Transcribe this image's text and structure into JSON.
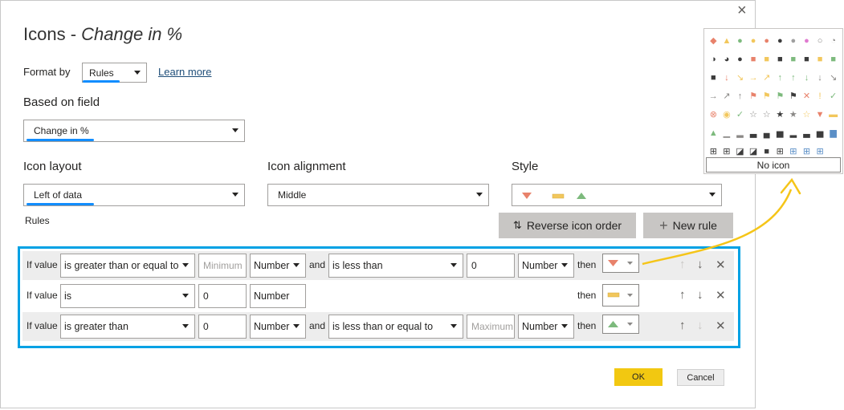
{
  "dialog": {
    "title_main": "Icons - ",
    "title_italic": "Change in %",
    "close": "×"
  },
  "format_by": {
    "label": "Format by",
    "value": "Rules",
    "learn_more": "Learn more"
  },
  "based_on_field": {
    "label": "Based on field",
    "value": "Change in %"
  },
  "icon_layout": {
    "label": "Icon layout",
    "value": "Left of data"
  },
  "icon_alignment": {
    "label": "Icon alignment",
    "value": "Middle"
  },
  "style": {
    "label": "Style"
  },
  "rules_label": "Rules",
  "buttons": {
    "reverse": "Reverse icon order",
    "new_rule": "New rule",
    "ok": "OK",
    "cancel": "Cancel"
  },
  "rules": [
    {
      "if_label": "If value",
      "op1": "is greater than or equal to",
      "val1_placeholder": "Minimum",
      "type1": "Number",
      "and": "and",
      "op2": "is less than",
      "val2": "0",
      "type2": "Number",
      "then": "then",
      "icon": "red-down-triangle-icon"
    },
    {
      "if_label": "If value",
      "op1": "is",
      "val1": "0",
      "type1": "Number",
      "then": "then",
      "icon": "yellow-bar-icon"
    },
    {
      "if_label": "If value",
      "op1": "is greater than",
      "val1": "0",
      "type1": "Number",
      "and": "and",
      "op2": "is less than or equal to",
      "val2_placeholder": "Maximum",
      "type2": "Number",
      "then": "then",
      "icon": "green-up-triangle-icon"
    }
  ],
  "palette": {
    "no_icon": "No icon"
  },
  "colors": {
    "accent_blue": "#00a1e4",
    "underline_blue": "#118dff",
    "ok_yellow": "#f2c811",
    "annotation_yellow": "#f5c518"
  }
}
